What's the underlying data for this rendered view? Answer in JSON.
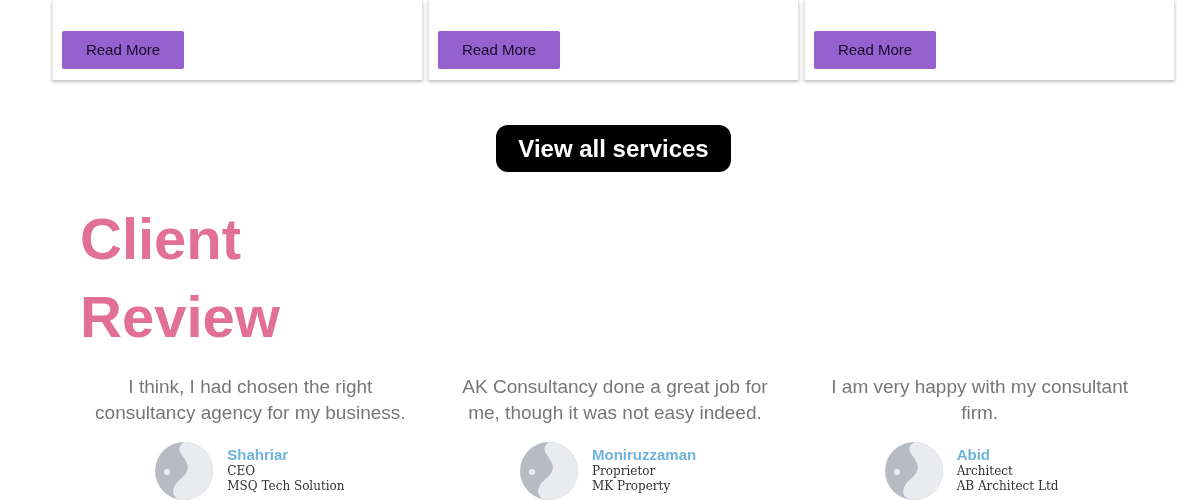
{
  "service_cards": [
    {
      "button": "Read More"
    },
    {
      "button": "Read More"
    },
    {
      "button": "Read More"
    }
  ],
  "view_all_button": "View all services",
  "reviews_section": {
    "heading": "Client Review",
    "reviews": [
      {
        "quote": "I think, I had chosen the right consultancy agency for my business.",
        "name": "Shahriar",
        "role": "CEO",
        "company": "MSQ Tech Solution"
      },
      {
        "quote": "AK Consultancy done a great job for me, though it was not easy indeed.",
        "name": "Moniruzzaman",
        "role": "Proprietor",
        "company": "MK Property"
      },
      {
        "quote": "I am very happy with my consultant firm.",
        "name": "Abid",
        "role": "Architect",
        "company": "AB Architect Ltd"
      }
    ]
  }
}
